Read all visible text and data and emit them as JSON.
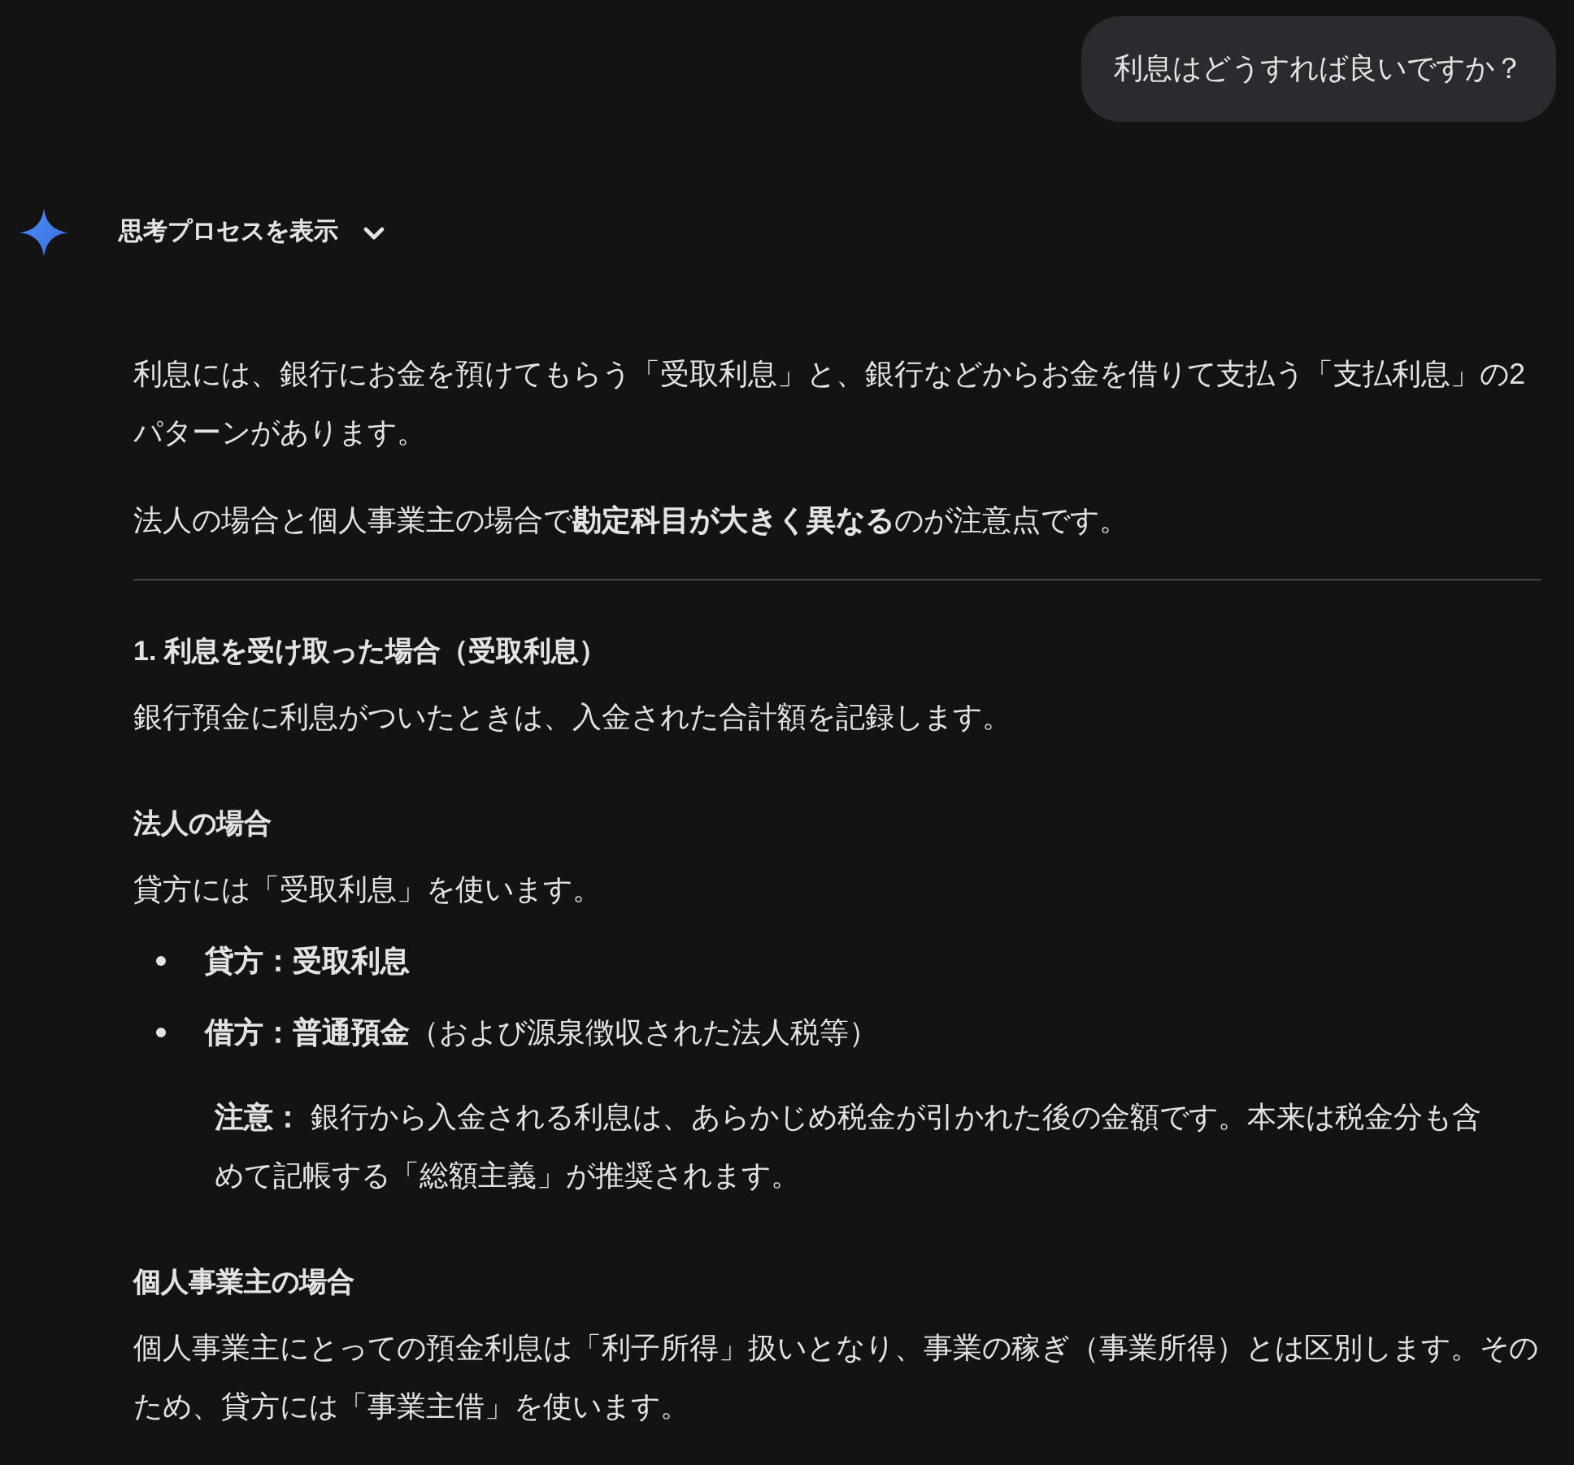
{
  "user_message": "利息はどうすれば良いですか？",
  "thoughts_toggle": {
    "label": "思考プロセスを表示",
    "expanded": false
  },
  "blocks": [
    {
      "kind": "paragraph",
      "text": "利息には、銀行にお金を預けてもらう「受取利息」と、銀行などからお金を借りて支払う「支払利息」の2パターンがあります。"
    },
    {
      "kind": "paragraph",
      "text": "法人の場合と個人事業主の場合で**勘定科目が大きく異なる**のが注意点です。"
    },
    {
      "kind": "divider"
    },
    {
      "kind": "heading",
      "text": "1. 利息を受け取った場合（受取利息）"
    },
    {
      "kind": "paragraph",
      "text": "銀行預金に利息がついたときは、入金された合計額を記録します。"
    },
    {
      "kind": "heading",
      "text": "法人の場合"
    },
    {
      "kind": "paragraph",
      "text": "貸方には「受取利息」を使います。"
    },
    {
      "kind": "bullets",
      "items": [
        "**貸方：受取利息**",
        "**借方：普通預金**（および源泉徴収された法人税等）"
      ]
    },
    {
      "kind": "note",
      "text": "**注意：** 銀行から入金される利息は、あらかじめ税金が引かれた後の金額です。本来は税金分も含めて記帳する「総額主義」が推奨されます。"
    },
    {
      "kind": "heading",
      "text": "個人事業主の場合"
    },
    {
      "kind": "paragraph",
      "text": "個人事業主にとっての預金利息は「利子所得」扱いとなり、事業の稼ぎ（事業所得）とは区別します。そのため、貸方には「事業主借」を使います。"
    }
  ]
}
